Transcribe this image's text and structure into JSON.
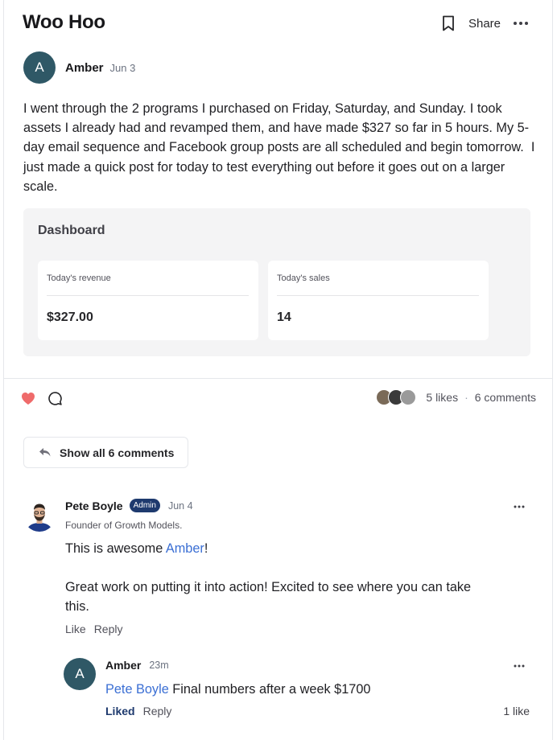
{
  "post": {
    "title": "Woo Hoo",
    "share_label": "Share",
    "author": {
      "initial": "A",
      "name": "Amber",
      "date": "Jun 3",
      "avatar_color": "#2f5866"
    },
    "body": "I went through the 2 programs I purchased on Friday, Saturday, and Sunday. I took assets I already had and revamped them, and have made $327 so far in 5 hours. My 5-day email sequence and Facebook group posts are all scheduled and begin tomorrow.  I just made a quick post for today to test everything out before it goes out on a larger scale.",
    "dashboard": {
      "title": "Dashboard",
      "cards": [
        {
          "label": "Today's revenue",
          "value": "$327.00"
        },
        {
          "label": "Today's sales",
          "value": "14"
        }
      ]
    },
    "likes_text": "5 likes",
    "separator": "·",
    "comments_text": "6 comments",
    "heart_color": "#ef6b6b",
    "show_all_label": "Show all 6 comments"
  },
  "comment": {
    "name": "Pete Boyle",
    "badge": "Admin",
    "date": "Jun 4",
    "subtitle": "Founder of Growth Models.",
    "line1_prefix": "This is awesome ",
    "line1_mention": "Amber",
    "line1_suffix": "!",
    "line2": "Great work on putting it into action! Excited to see where you can take this.",
    "like_label": "Like",
    "reply_label": "Reply",
    "badge_color": "#1e3a6e"
  },
  "reply": {
    "initial": "A",
    "name": "Amber",
    "date": "23m",
    "mention": "Pete Boyle",
    "text": " Final numbers after a week $1700",
    "liked_label": "Liked",
    "reply_label": "Reply",
    "likes_text": "1 like"
  }
}
